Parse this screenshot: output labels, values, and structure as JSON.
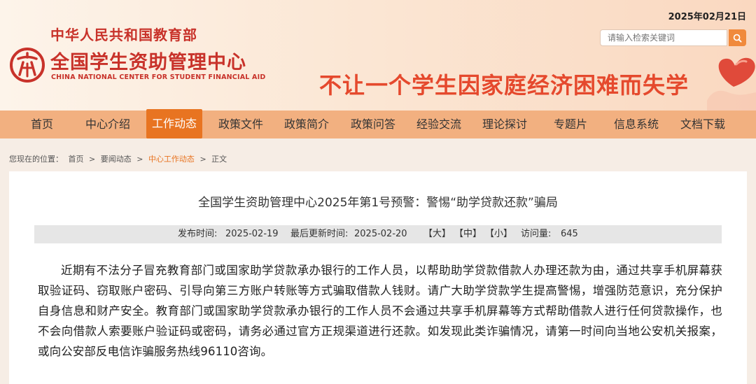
{
  "header": {
    "date": "2025年02月21日",
    "search_placeholder": "请输入检索关键词",
    "ministry": "中华人民共和国教育部",
    "center_name": "全国学生资助管理中心",
    "center_name_en": "CHINA NATIONAL CENTER FOR STUDENT FINANCIAL AID",
    "slogan": "不让一个学生因家庭经济困难而失学",
    "accent_color": "#c8322a"
  },
  "nav": {
    "items": [
      {
        "label": "首页"
      },
      {
        "label": "中心介绍"
      },
      {
        "label": "工作动态"
      },
      {
        "label": "政策文件"
      },
      {
        "label": "政策简介"
      },
      {
        "label": "政策问答"
      },
      {
        "label": "经验交流"
      },
      {
        "label": "理论探讨"
      },
      {
        "label": "专题片"
      },
      {
        "label": "信息系统"
      },
      {
        "label": "文档下载"
      }
    ],
    "active": "工作动态",
    "active_color": "#e87421"
  },
  "breadcrumb": {
    "prefix": "您现在的位置：",
    "items": [
      "首页",
      "要闻动态",
      "中心工作动态",
      "正文"
    ],
    "separator": ">"
  },
  "article": {
    "title": "全国学生资助管理中心2025年第1号预警：警惕“助学贷款还款”骗局",
    "publish_label": "发布时间:",
    "publish_date": "2025-02-19",
    "update_label": "最后更新时间:",
    "update_date": "2025-02-20",
    "size_large": "【大】",
    "size_medium": "【中】",
    "size_small": "【小】",
    "visits_label": "访问量:",
    "visits": "645",
    "body": "近期有不法分子冒充教育部门或国家助学贷款承办银行的工作人员，以帮助助学贷款借款人办理还款为由，通过共享手机屏幕获取验证码、窃取账户密码、引导向第三方账户转账等方式骗取借款人钱财。请广大助学贷款学生提高警惕，增强防范意识，充分保护自身信息和财产安全。教育部门或国家助学贷款承办银行的工作人员不会通过共享手机屏幕等方式帮助借款人进行任何贷款操作，也不会向借款人索要账户验证码或密码，请务必通过官方正规渠道进行还款。如发现此类诈骗情况，请第一时间向当地公安机关报案，或向公安部反电信诈骗服务热线96110咨询。"
  }
}
